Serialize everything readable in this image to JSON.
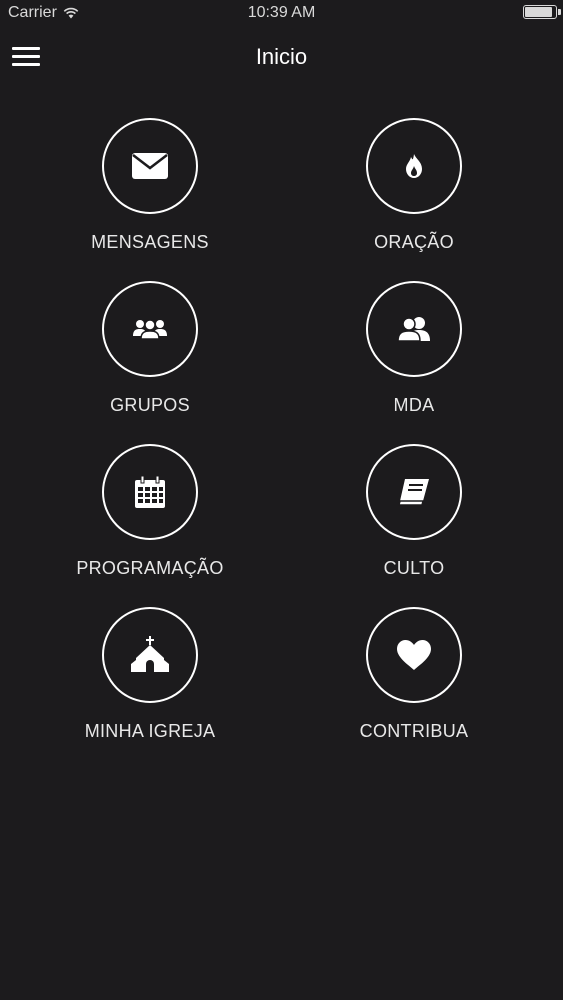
{
  "status_bar": {
    "carrier": "Carrier",
    "time": "10:39 AM",
    "battery_level": 0.9,
    "wifi_icon": "wifi-icon",
    "battery_icon": "battery-icon"
  },
  "nav": {
    "title": "Inicio",
    "menu_icon": "hamburger-menu-icon"
  },
  "tiles": [
    {
      "label": "MENSAGENS",
      "icon": "envelope-icon"
    },
    {
      "label": "ORAÇÃO",
      "icon": "flame-icon"
    },
    {
      "label": "GRUPOS",
      "icon": "group-icon"
    },
    {
      "label": "MDA",
      "icon": "users-icon"
    },
    {
      "label": "PROGRAMAÇÃO",
      "icon": "calendar-icon"
    },
    {
      "label": "CULTO",
      "icon": "book-icon"
    },
    {
      "label": "MINHA IGREJA",
      "icon": "church-icon"
    },
    {
      "label": "CONTRIBUA",
      "icon": "heart-icon"
    }
  ],
  "colors": {
    "background": "#1c1b1d",
    "foreground": "#ffffff"
  }
}
